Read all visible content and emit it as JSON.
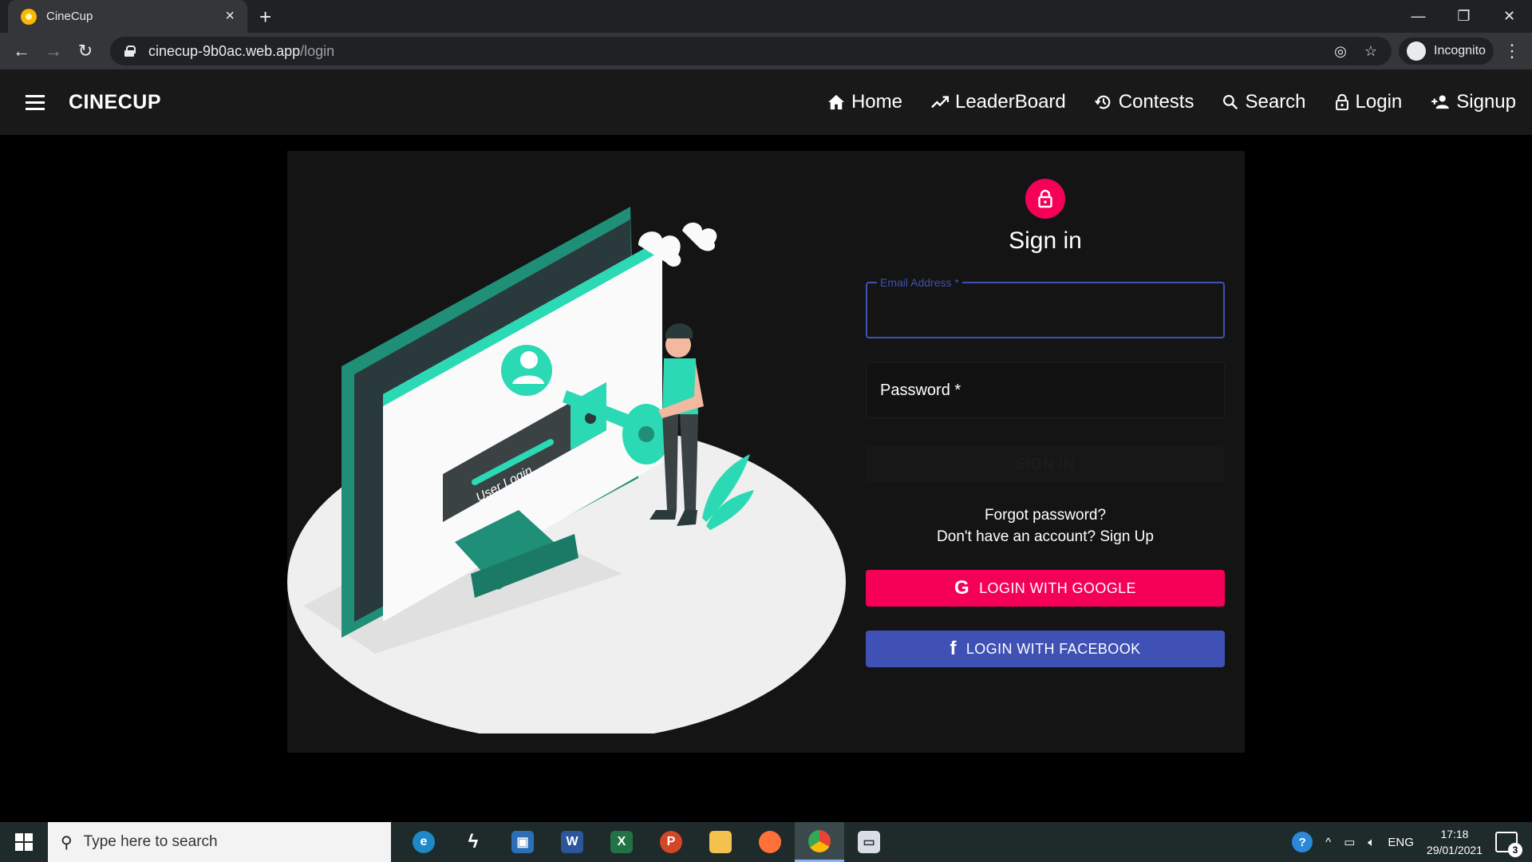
{
  "browser": {
    "tab_title": "CineCup",
    "url_host": "cinecup-9b0ac.web.app",
    "url_path": "/login",
    "profile_label": "Incognito"
  },
  "app": {
    "brand": "CINECUP",
    "nav": [
      {
        "label": "Home",
        "icon": "home-icon"
      },
      {
        "label": "LeaderBoard",
        "icon": "trending-up-icon"
      },
      {
        "label": "Contests",
        "icon": "history-icon"
      },
      {
        "label": "Search",
        "icon": "search-icon"
      },
      {
        "label": "Login",
        "icon": "lock-icon"
      },
      {
        "label": "Signup",
        "icon": "person-add-icon"
      }
    ]
  },
  "illustration": {
    "screen_text": "User Login"
  },
  "form": {
    "title": "Sign in",
    "email_label": "Email Address *",
    "password_label": "Password *",
    "signin_button": "SIGN IN",
    "forgot_link": "Forgot password?",
    "signup_link": "Don't have an account? Sign Up",
    "google_button": "LOGIN WITH GOOGLE",
    "facebook_button": "LOGIN WITH FACEBOOK"
  },
  "taskbar": {
    "search_placeholder": "Type here to search",
    "language": "ENG",
    "time": "17:18",
    "date": "29/01/2021",
    "notification_count": "3"
  },
  "colors": {
    "accent_pink": "#f50057",
    "accent_indigo": "#3f51b5",
    "illustration_teal": "#2bd9b4"
  }
}
